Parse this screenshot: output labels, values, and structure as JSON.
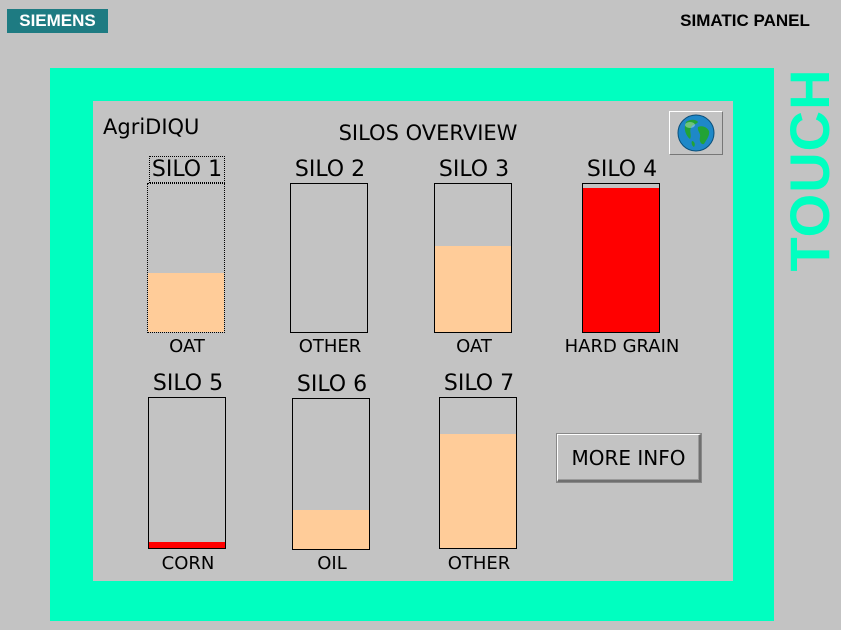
{
  "header": {
    "brand": "SIEMENS",
    "panel_name": "SIMATIC PANEL",
    "side_label": "TOUCH"
  },
  "screen": {
    "app_name": "AgriDIQU",
    "title": "SILOS OVERVIEW",
    "more_info_label": "MORE INFO"
  },
  "silos": [
    {
      "name": "SILO 1",
      "content": "OAT",
      "level_percent": 40,
      "fill_color": "#ffcc99"
    },
    {
      "name": "SILO 2",
      "content": "OTHER",
      "level_percent": 0,
      "fill_color": "#ffcc99"
    },
    {
      "name": "SILO 3",
      "content": "OAT",
      "level_percent": 58,
      "fill_color": "#ffcc99"
    },
    {
      "name": "SILO 4",
      "content": "HARD GRAIN",
      "level_percent": 97,
      "fill_color": "#ff0000"
    },
    {
      "name": "SILO 5",
      "content": "CORN",
      "level_percent": 4,
      "fill_color": "#ff0000"
    },
    {
      "name": "SILO 6",
      "content": "OIL",
      "level_percent": 26,
      "fill_color": "#ffcc99"
    },
    {
      "name": "SILO 7",
      "content": "OTHER",
      "level_percent": 76,
      "fill_color": "#ffcc99"
    }
  ],
  "colors": {
    "bezel": "#00ffc0",
    "background": "#c3c3c3",
    "brand_badge": "#1e7b82",
    "level_normal": "#ffcc99",
    "level_alarm": "#ff0000"
  },
  "icons": {
    "globe_button": "globe-icon"
  }
}
